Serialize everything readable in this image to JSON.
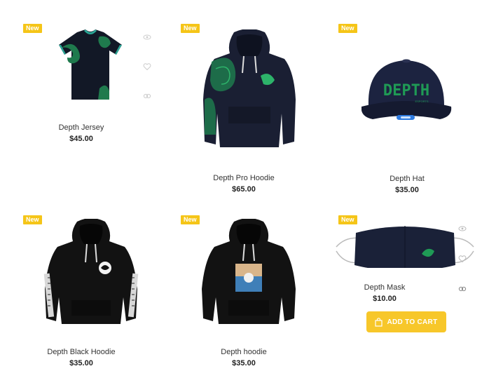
{
  "products": [
    {
      "badge": "New",
      "name": "Depth Jersey",
      "price": "$45.00",
      "image": "jersey"
    },
    {
      "badge": "New",
      "name": "Depth Pro Hoodie",
      "price": "$65.00",
      "image": "pro-hoodie"
    },
    {
      "badge": "New",
      "name": "Depth Hat",
      "price": "$35.00",
      "image": "hat"
    },
    {
      "badge": "New",
      "name": "Depth Black Hoodie",
      "price": "$35.00",
      "image": "black-hoodie"
    },
    {
      "badge": "New",
      "name": "Depth hoodie",
      "price": "$35.00",
      "image": "hoodie-photo"
    },
    {
      "badge": "New",
      "name": "Depth Mask",
      "price": "$10.00",
      "image": "mask"
    }
  ],
  "hat_logo_text": "DEPTH",
  "hat_sub_text": "ESPORTS",
  "actions": {
    "add_to_cart_label": "ADD TO CART"
  },
  "colors": {
    "badge": "#f5c518",
    "button": "#f7c72a",
    "garment": "#141a2b",
    "pattern": "#1f7a4d"
  },
  "icons": [
    "quick-view-icon",
    "heart-icon",
    "compare-icon",
    "bag-icon"
  ]
}
